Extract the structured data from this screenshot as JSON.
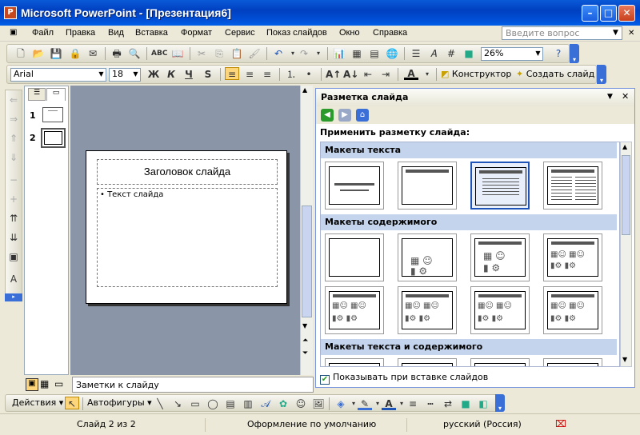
{
  "window": {
    "title": "Microsoft PowerPoint - [Презентация6]",
    "minimize": "–",
    "maximize": "□",
    "close": "✕"
  },
  "menu": {
    "items": [
      "Файл",
      "Правка",
      "Вид",
      "Вставка",
      "Формат",
      "Сервис",
      "Показ слайдов",
      "Окно",
      "Справка"
    ],
    "help_placeholder": "Введите вопрос"
  },
  "toolbar": {
    "zoom": "26%"
  },
  "format_toolbar": {
    "font": "Arial",
    "size": "18",
    "bold": "Ж",
    "italic": "К",
    "underline": "Ч",
    "shadow": "S",
    "designer_label": "Конструктор",
    "new_slide_label": "Создать слайд"
  },
  "slides_pane": {
    "numbers": [
      "1",
      "2"
    ]
  },
  "slide": {
    "title_placeholder": "Заголовок слайда",
    "body_placeholder": "• Текст слайда"
  },
  "task_pane": {
    "title": "Разметка слайда",
    "apply_label": "Применить разметку слайда:",
    "sections": [
      {
        "name": "Макеты текста"
      },
      {
        "name": "Макеты содержимого"
      },
      {
        "name": "Макеты текста и содержимого"
      }
    ],
    "show_on_insert_label": "Показывать при вставке слайдов",
    "show_on_insert_checked": true
  },
  "notes": {
    "placeholder": "Заметки к слайду"
  },
  "draw_toolbar": {
    "actions_label": "Действия",
    "autoshapes_label": "Автофигуры"
  },
  "status": {
    "slide": "Слайд 2 из 2",
    "design": "Оформление по умолчанию",
    "language": "русский (Россия)"
  },
  "colors": {
    "titlebar": "#0050d8",
    "selection": "#1e54b8",
    "section_header": "#c4d4ec"
  }
}
